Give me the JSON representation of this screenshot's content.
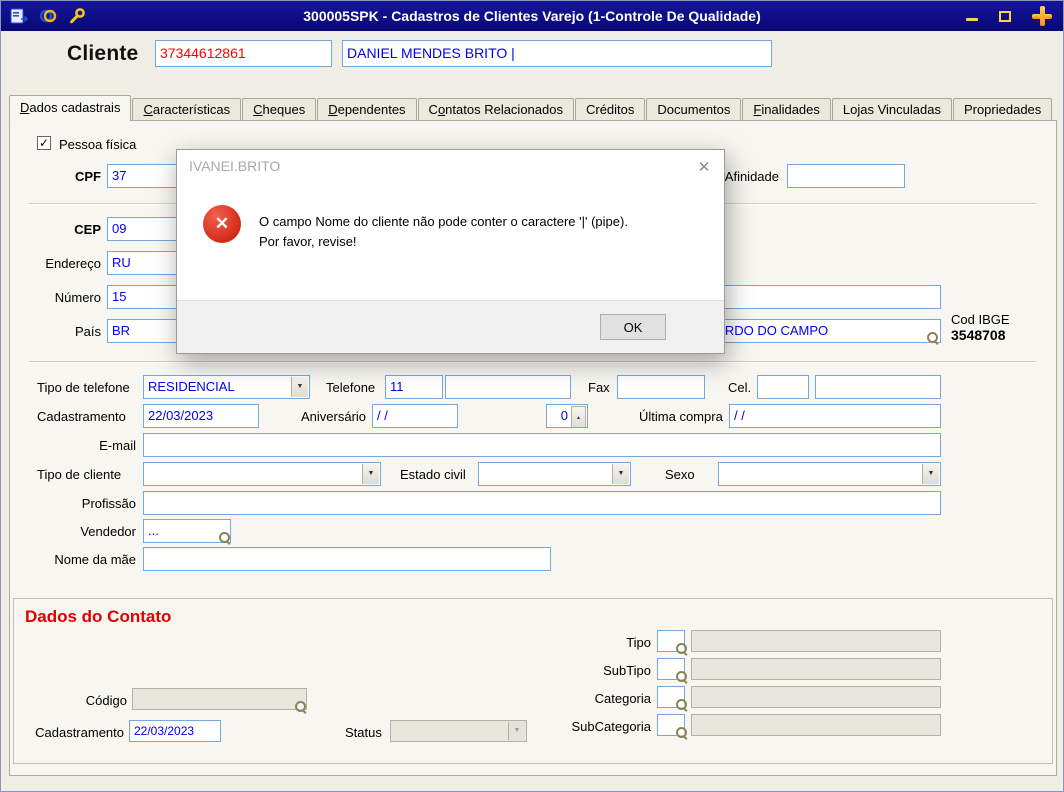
{
  "colors": {
    "titlebar_bg": "#0d0d85",
    "field_border": "#74a7dc",
    "value_text": "#0000f0",
    "client_code_text": "#ff0000",
    "contato_heading": "#e00000",
    "error_icon_red": "#d3200c",
    "window_button_yellow": "#ffd24a",
    "close_plus_orange": "#ff9a1a"
  },
  "icons": {
    "check": "✓",
    "dropdown": "▼",
    "spin_up": "▲",
    "spin_down": "▼",
    "close_x": "✕",
    "error_x": "✕"
  },
  "titlebar": {
    "title": "300005SPK - Cadastros de Clientes Varejo (1-Controle De Qualidade)"
  },
  "header": {
    "label": "Cliente",
    "code": "37344612861",
    "name": "DANIEL MENDES BRITO |"
  },
  "tabs": {
    "active": "Dados cadastrais",
    "items": [
      {
        "label": "Dados cadastrais",
        "u": 0
      },
      {
        "label": "Características",
        "u": 0
      },
      {
        "label": "Cheques",
        "u": 0
      },
      {
        "label": "Dependentes",
        "u": 0
      },
      {
        "label": "Contatos Relacionados",
        "u": 1
      },
      {
        "label": "Créditos",
        "u": -1
      },
      {
        "label": "Documentos",
        "u": -1
      },
      {
        "label": "Finalidades",
        "u": 0
      },
      {
        "label": "Lojas Vinculadas",
        "u": -1
      },
      {
        "label": "Propriedades",
        "u": -1
      }
    ]
  },
  "form": {
    "pessoa_fisica": {
      "label": "Pessoa física",
      "checked": true
    },
    "cpf": {
      "label": "CPF",
      "value": "37"
    },
    "afinidade": {
      "label": "Afinidade",
      "value": ""
    },
    "cep": {
      "label": "CEP",
      "value": "09"
    },
    "endereco": {
      "label": "Endereço",
      "value": "RU"
    },
    "numero": {
      "label": "Número",
      "value": "15",
      "extra": ""
    },
    "pais": {
      "label": "País",
      "value": "BR"
    },
    "cidade": {
      "value": "SÃO BERNARDO DO CAMPO"
    },
    "cod_ibge": {
      "label": "Cod IBGE",
      "value": "3548708"
    },
    "tipo_telefone": {
      "label": "Tipo de telefone",
      "value": "RESIDENCIAL"
    },
    "telefone": {
      "label": "Telefone",
      "ddd": "11",
      "numero": ""
    },
    "fax": {
      "label": "Fax",
      "value": ""
    },
    "cel": {
      "label": "Cel.",
      "ddd": "",
      "numero": ""
    },
    "cadastramento": {
      "label": "Cadastramento",
      "value": "22/03/2023"
    },
    "aniversario": {
      "label": "Aniversário",
      "value": "/ /"
    },
    "aniversario_spin": {
      "value": "0"
    },
    "ultima_compra": {
      "label": "Última compra",
      "value": "/ /"
    },
    "email": {
      "label": "E-mail",
      "value": ""
    },
    "tipo_cliente": {
      "label": "Tipo de cliente",
      "value": ""
    },
    "estado_civil": {
      "label": "Estado civil",
      "value": ""
    },
    "sexo": {
      "label": "Sexo",
      "value": ""
    },
    "profissao": {
      "label": "Profissão",
      "value": ""
    },
    "vendedor": {
      "label": "Vendedor",
      "value": "..."
    },
    "nome_mae": {
      "label": "Nome da mãe",
      "value": ""
    }
  },
  "contato": {
    "title": "Dados do Contato",
    "codigo": {
      "label": "Código",
      "value": ""
    },
    "cadastramento": {
      "label": "Cadastramento",
      "value": "22/03/2023"
    },
    "status": {
      "label": "Status",
      "value": ""
    },
    "tipo": {
      "label": "Tipo",
      "code": "",
      "value": ""
    },
    "subtipo": {
      "label": "SubTipo",
      "code": "",
      "value": ""
    },
    "categoria": {
      "label": "Categoria",
      "code": "",
      "value": ""
    },
    "subcategoria": {
      "label": "SubCategoria",
      "code": "",
      "value": ""
    }
  },
  "dialog": {
    "title": "IVANEI.BRITO",
    "message": "O campo Nome do cliente não pode conter o caractere '|' (pipe). Por favor, revise!",
    "ok": "OK"
  }
}
